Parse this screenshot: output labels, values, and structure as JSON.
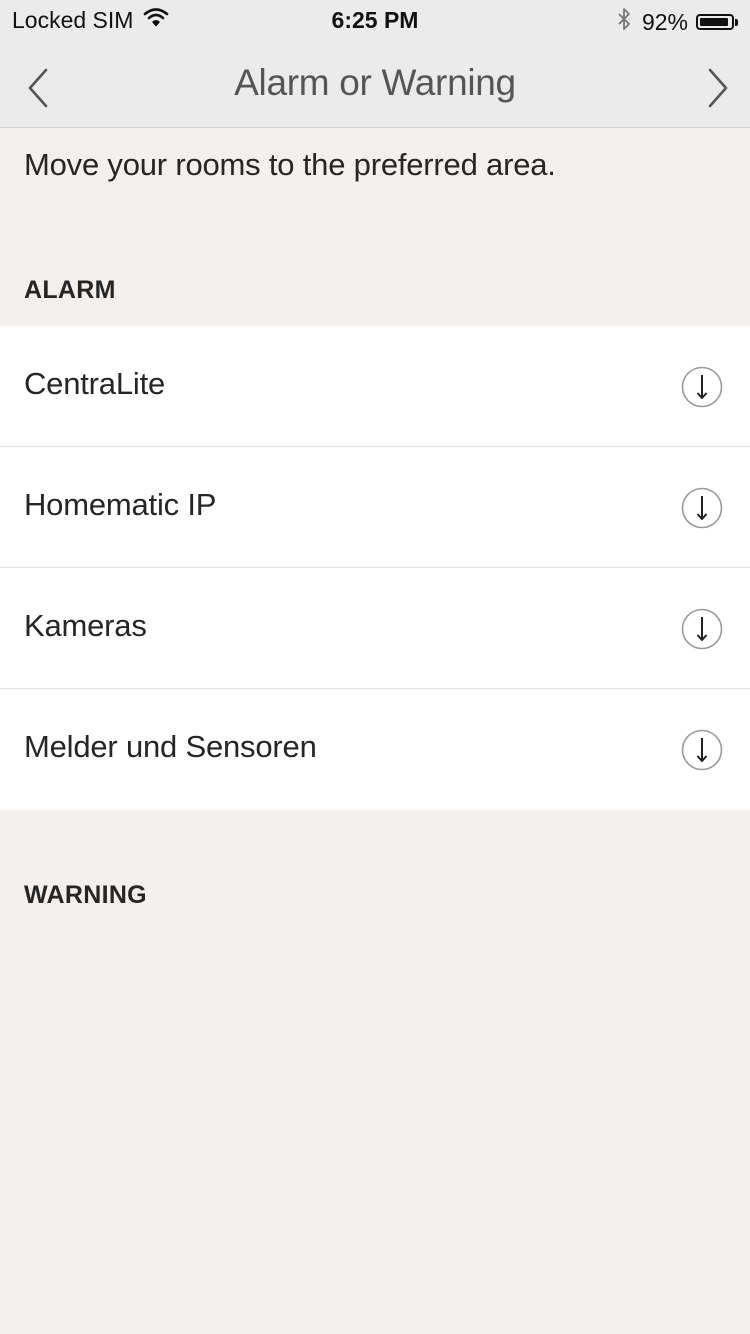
{
  "status_bar": {
    "carrier": "Locked SIM",
    "time": "6:25 PM",
    "battery_percent": "92%",
    "battery_level": 0.92,
    "icons": [
      "wifi-icon",
      "bluetooth-icon",
      "battery-icon"
    ]
  },
  "nav": {
    "title": "Alarm or Warning",
    "back_icon": "chevron-left-icon",
    "forward_icon": "chevron-right-icon"
  },
  "intro_text": "Move your rooms to the preferred area.",
  "sections": {
    "alarm": {
      "header": "ALARM",
      "items": [
        {
          "label": "CentraLite",
          "icon": "arrow-down-circle-icon"
        },
        {
          "label": "Homematic IP",
          "icon": "arrow-down-circle-icon"
        },
        {
          "label": "Kameras",
          "icon": "arrow-down-circle-icon"
        },
        {
          "label": "Melder und Sensoren",
          "icon": "arrow-down-circle-icon"
        }
      ]
    },
    "warning": {
      "header": "WARNING",
      "items": []
    }
  },
  "colors": {
    "background": "#f4f0ed",
    "bar": "#ebebeb",
    "text": "#262626"
  }
}
